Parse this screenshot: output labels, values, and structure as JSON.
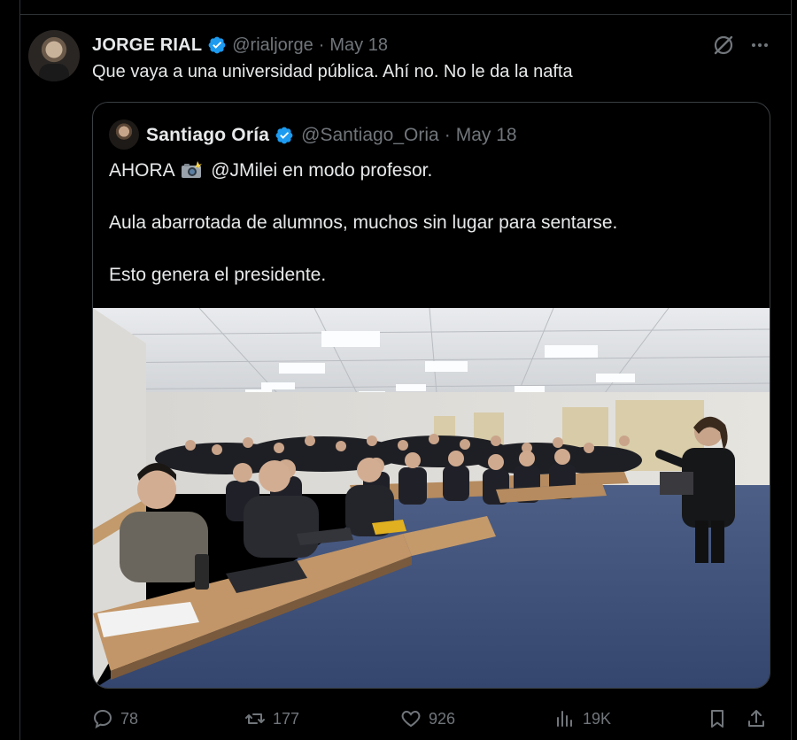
{
  "tweet": {
    "author_name": "JORGE RIAL",
    "handle": "@rialjorge",
    "separator": "·",
    "date": "May 18",
    "text": "Que vaya a una universidad pública. Ahí no. No le da la nafta",
    "icons": {
      "verified": "verified-badge-icon",
      "grok": "grok-icon",
      "more": "more-options-icon"
    }
  },
  "quoted": {
    "author_name": "Santiago Oría",
    "handle": "@Santiago_Oria",
    "separator": "·",
    "date": "May 18",
    "line1_prefix": "AHORA",
    "line1_suffix": "@JMilei en modo profesor.",
    "line2": "Aula abarrotada de alumnos, muchos sin lugar para sentarse.",
    "line3": "Esto genera el presidente.",
    "photo": "classroom-photo"
  },
  "actions": {
    "replies": "78",
    "reposts": "177",
    "likes": "926",
    "views": "19K",
    "icons": [
      "reply-icon",
      "repost-icon",
      "like-icon",
      "views-icon",
      "bookmark-icon",
      "share-icon"
    ]
  },
  "colors": {
    "background": "#000000",
    "verified": "#1d9bf0",
    "muted": "#71767b",
    "text": "#e7e9ea",
    "border": "#2f3336"
  }
}
